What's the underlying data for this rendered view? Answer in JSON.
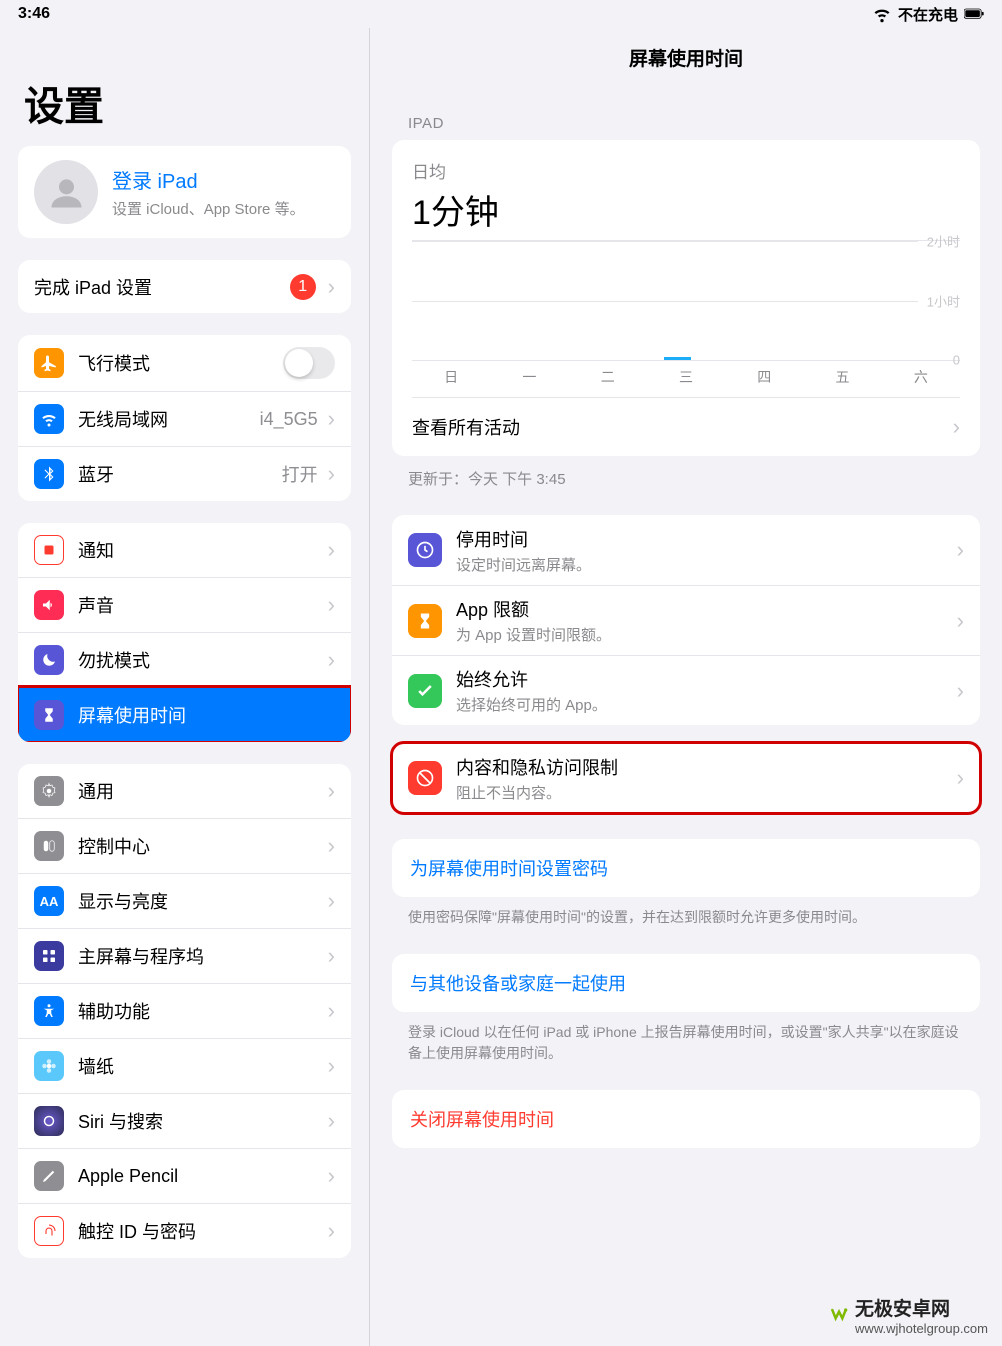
{
  "status": {
    "time": "3:46",
    "charge": "不在充电"
  },
  "sidebar": {
    "title": "设置",
    "signin": {
      "title": "登录 iPad",
      "subtitle": "设置 iCloud、App Store 等。"
    },
    "finish": {
      "label": "完成 iPad 设置",
      "badge": "1"
    },
    "network": {
      "airplane": "飞行模式",
      "wifi": "无线局域网",
      "wifi_value": "i4_5G5",
      "bluetooth": "蓝牙",
      "bluetooth_value": "打开"
    },
    "attention": {
      "notifications": "通知",
      "sounds": "声音",
      "dnd": "勿扰模式",
      "screentime": "屏幕使用时间"
    },
    "general": {
      "general": "通用",
      "control": "控制中心",
      "display": "显示与亮度",
      "home": "主屏幕与程序坞",
      "accessibility": "辅助功能",
      "wallpaper": "墙纸",
      "siri": "Siri 与搜索",
      "pencil": "Apple Pencil",
      "touchid": "触控 ID 与密码"
    }
  },
  "detail": {
    "title": "屏幕使用时间",
    "device": "IPAD",
    "avg_label": "日均",
    "avg_value": "1分钟",
    "axis_top": "2小时",
    "axis_mid": "1小时",
    "axis_zero": "0",
    "days": [
      "日",
      "一",
      "二",
      "三",
      "四",
      "五",
      "六"
    ],
    "see_all": "查看所有活动",
    "updated": "更新于：今天 下午 3:45",
    "items": {
      "downtime": {
        "title": "停用时间",
        "sub": "设定时间远离屏幕。"
      },
      "limits": {
        "title": "App 限额",
        "sub": "为 App 设置时间限额。"
      },
      "allowed": {
        "title": "始终允许",
        "sub": "选择始终可用的 App。"
      },
      "content": {
        "title": "内容和隐私访问限制",
        "sub": "阻止不当内容。"
      }
    },
    "passcode": {
      "link": "为屏幕使用时间设置密码",
      "note": "使用密码保障\"屏幕使用时间\"的设置，并在达到限额时允许更多使用时间。"
    },
    "share": {
      "link": "与其他设备或家庭一起使用",
      "note": "登录 iCloud 以在任何 iPad 或 iPhone 上报告屏幕使用时间，或设置\"家人共享\"以在家庭设备上使用屏幕使用时间。"
    },
    "turnoff": "关闭屏幕使用时间"
  },
  "chart_data": {
    "type": "bar",
    "categories": [
      "日",
      "一",
      "二",
      "三",
      "四",
      "五",
      "六"
    ],
    "values": [
      0,
      0,
      0,
      0.05,
      0,
      0,
      0
    ],
    "ylabel": "小时",
    "ylim": [
      0,
      2
    ],
    "title": "日均 1分钟"
  },
  "watermark": {
    "title": "无极安卓网",
    "url": "www.wjhotelgroup.com"
  }
}
